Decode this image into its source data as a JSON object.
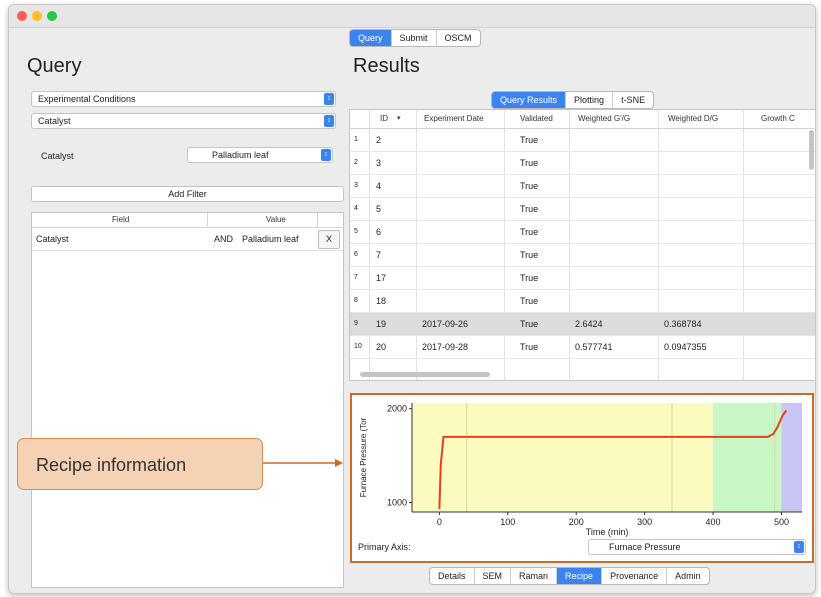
{
  "top_tabs": [
    "Query",
    "Submit",
    "OSCM"
  ],
  "query": {
    "title": "Query",
    "condition_type": "Experimental Conditions",
    "parameter": "Catalyst",
    "filter_label": "Catalyst",
    "filter_value": "Palladium leaf",
    "add_filter": "Add Filter",
    "table_headers": [
      "Field",
      "Value"
    ],
    "filters": [
      {
        "field": "Catalyst",
        "op": "AND",
        "value": "Palladium leaf",
        "remove": "X"
      }
    ]
  },
  "results": {
    "title": "Results",
    "tabs": [
      "Query Results",
      "Plotting",
      "t-SNE"
    ],
    "columns": [
      "ID",
      "Experiment Date",
      "Validated",
      "Weighted G'/G",
      "Weighted D/G",
      "Growth C"
    ],
    "rows": [
      {
        "n": "1",
        "id": "2",
        "date": "",
        "validated": "True",
        "g": "",
        "d": ""
      },
      {
        "n": "2",
        "id": "3",
        "date": "",
        "validated": "True",
        "g": "",
        "d": ""
      },
      {
        "n": "3",
        "id": "4",
        "date": "",
        "validated": "True",
        "g": "",
        "d": ""
      },
      {
        "n": "4",
        "id": "5",
        "date": "",
        "validated": "True",
        "g": "",
        "d": ""
      },
      {
        "n": "5",
        "id": "6",
        "date": "",
        "validated": "True",
        "g": "",
        "d": ""
      },
      {
        "n": "6",
        "id": "7",
        "date": "",
        "validated": "True",
        "g": "",
        "d": ""
      },
      {
        "n": "7",
        "id": "17",
        "date": "",
        "validated": "True",
        "g": "",
        "d": ""
      },
      {
        "n": "8",
        "id": "18",
        "date": "",
        "validated": "True",
        "g": "",
        "d": ""
      },
      {
        "n": "9",
        "id": "19",
        "date": "2017-09-26",
        "validated": "True",
        "g": "2.6424",
        "d": "0.368784"
      },
      {
        "n": "10",
        "id": "20",
        "date": "2017-09-28",
        "validated": "True",
        "g": "0.577741",
        "d": "0.0947355"
      }
    ],
    "selected_row": 8
  },
  "plot": {
    "primary_axis_label": "Primary Axis:",
    "primary_axis_value": "Furnace Pressure"
  },
  "chart_data": {
    "type": "line",
    "xlabel": "Time (min)",
    "ylabel": "Furnace Pressure (Torr)",
    "ylabel_shown": "Furnace Pressure (Tor",
    "xlim": [
      -40,
      530
    ],
    "ylim": [
      900,
      2060
    ],
    "xticks": [
      0,
      100,
      200,
      300,
      400,
      500
    ],
    "yticks": [
      1000,
      2000
    ],
    "regions": [
      {
        "from": -40,
        "to": 400,
        "color": "#fafbbf"
      },
      {
        "from": 400,
        "to": 500,
        "color": "#c9f7c4"
      },
      {
        "from": 500,
        "to": 530,
        "color": "#c9c6f5"
      }
    ],
    "inner_lines": [
      40,
      340,
      490
    ],
    "series": [
      {
        "color": "#e8401c",
        "x": [
          0,
          2,
          6,
          12,
          480,
          488,
          494,
          498,
          502,
          507
        ],
        "y": [
          930,
          1400,
          1700,
          1700,
          1700,
          1730,
          1800,
          1870,
          1930,
          1980
        ]
      }
    ]
  },
  "bottom_tabs": [
    "Details",
    "SEM",
    "Raman",
    "Recipe",
    "Provenance",
    "Admin"
  ],
  "active_bottom_tab": "Recipe",
  "callout": "Recipe information",
  "colors": {
    "accent": "#3b84f0",
    "highlight": "#cf6b21",
    "callout_fill": "#f6d2b4"
  }
}
